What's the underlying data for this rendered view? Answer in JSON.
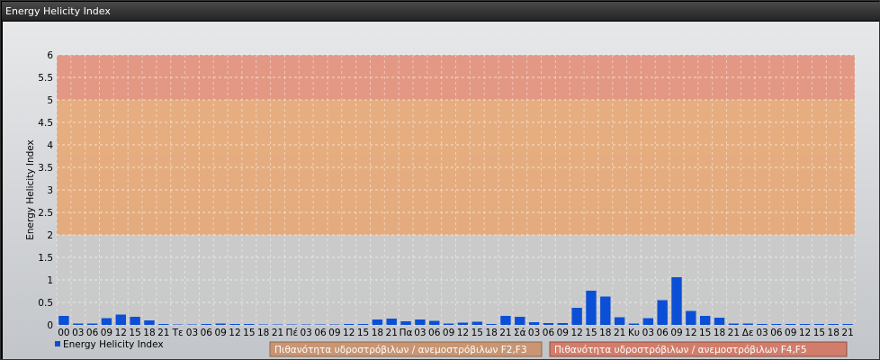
{
  "window": {
    "title": "Energy Helicity Index"
  },
  "colors": {
    "bar": "#0b4fd6",
    "band_low": "#c9c9c9",
    "band_mid": "#e7a56f",
    "band_high": "#e38b73",
    "legend_mid": "#c99572",
    "legend_high": "#d27d6b"
  },
  "chart_data": {
    "type": "bar",
    "title": "",
    "xlabel": "",
    "ylabel": "Energy Helicity Index",
    "ylim": [
      0,
      6
    ],
    "yticks": [
      "0",
      "0.5",
      "1",
      "1.5",
      "2",
      "2.5",
      "3",
      "3.5",
      "4",
      "4.5",
      "5",
      "5.5",
      "6"
    ],
    "grid": true,
    "bands": [
      {
        "from": 0,
        "to": 2,
        "color": "#c9c9c9"
      },
      {
        "from": 2,
        "to": 5,
        "color": "#e7a56f",
        "label": "Πιθανότητα υδροστρόβιλων / ανεμοστρόβιλων F2,F3"
      },
      {
        "from": 5,
        "to": 6,
        "color": "#e38b73",
        "label": "Πιθανότητα υδροστρόβιλων / ανεμοστρόβιλων F4,F5"
      }
    ],
    "categories": [
      "00",
      "03",
      "06",
      "09",
      "12",
      "15",
      "18",
      "21",
      "Τε",
      "03",
      "06",
      "09",
      "12",
      "15",
      "18",
      "21",
      "Πέ",
      "03",
      "06",
      "09",
      "12",
      "15",
      "18",
      "21",
      "Πα",
      "03",
      "06",
      "09",
      "12",
      "15",
      "18",
      "21",
      "Σά",
      "03",
      "06",
      "09",
      "12",
      "15",
      "18",
      "21",
      "Κυ",
      "03",
      "06",
      "09",
      "12",
      "15",
      "18",
      "21",
      "Δε",
      "03",
      "06",
      "09",
      "12",
      "15",
      "18",
      "21"
    ],
    "series": [
      {
        "name": "Energy Helicity Index",
        "values": [
          0.2,
          0.03,
          0.03,
          0.15,
          0.23,
          0.18,
          0.1,
          0.02,
          0.01,
          0.01,
          0.02,
          0.03,
          0.02,
          0.02,
          0.01,
          0.01,
          0.01,
          0.01,
          0.01,
          0.01,
          0.02,
          0.02,
          0.12,
          0.14,
          0.08,
          0.12,
          0.09,
          0.03,
          0.05,
          0.07,
          0.02,
          0.2,
          0.18,
          0.06,
          0.04,
          0.04,
          0.38,
          0.76,
          0.63,
          0.17,
          0.03,
          0.15,
          0.55,
          1.06,
          0.31,
          0.2,
          0.16,
          0.03,
          0.03,
          0.02,
          0.02,
          0.02,
          0.02,
          0.02,
          0.02,
          0.02
        ]
      }
    ],
    "legend": "bottom-left"
  }
}
